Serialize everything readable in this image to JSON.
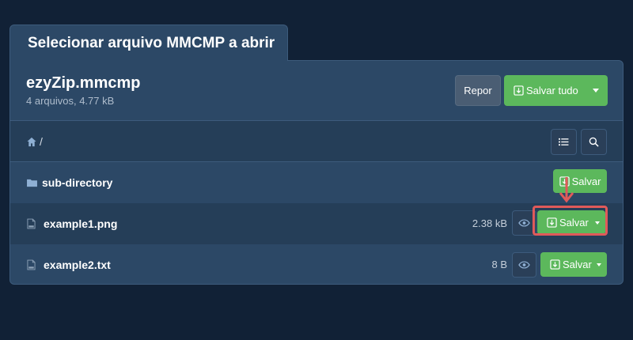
{
  "dialog": {
    "tab_title": "Selecionar arquivo MMCMP a abrir"
  },
  "archive": {
    "name": "ezyZip.mmcmp",
    "summary": "4 arquivos, 4.77 kB",
    "reset_label": "Repor",
    "save_all_label": "Salvar tudo"
  },
  "path": {
    "text": "/",
    "list_icon": "list-icon",
    "search_icon": "search-icon"
  },
  "rows": [
    {
      "name": "sub-directory",
      "type": "folder",
      "save_label": "Salvar"
    },
    {
      "name": "example1.png",
      "type": "file",
      "size": "2.38 kB",
      "save_label": "Salvar"
    },
    {
      "name": "example2.txt",
      "type": "file",
      "size": "8 B",
      "save_label": "Salvar"
    }
  ],
  "colors": {
    "background": "#112136",
    "panel": "#2c4866",
    "accent_green": "#5cb85c",
    "highlight": "#e05a5a"
  }
}
